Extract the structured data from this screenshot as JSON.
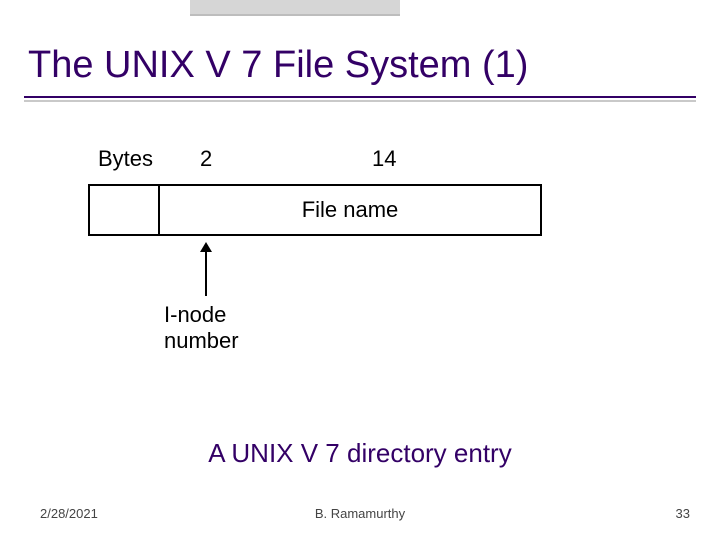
{
  "title": "The UNIX V 7 File System (1)",
  "diagram": {
    "bytes_label": "Bytes",
    "col1_bytes": "2",
    "col2_bytes": "14",
    "filename_label": "File name",
    "inode_label_line1": "I-node",
    "inode_label_line2": "number"
  },
  "caption": "A UNIX V 7 directory entry",
  "footer": {
    "date": "2/28/2021",
    "author": "B. Ramamurthy",
    "page": "33"
  }
}
